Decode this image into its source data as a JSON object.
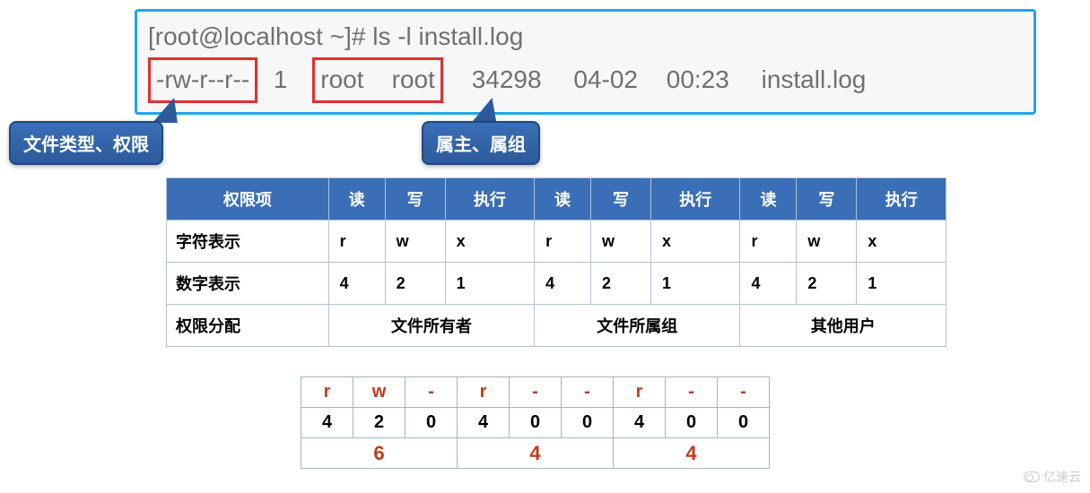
{
  "terminal": {
    "prompt": "[root@localhost ~]# ls -l install.log",
    "output": {
      "perm": "-rw-r--r--",
      "links": "1",
      "owner": "root",
      "group": "root",
      "size": "34298",
      "date": "04-02",
      "time": "00:23",
      "name": "install.log"
    }
  },
  "callouts": {
    "filetype_perm": "文件类型、权限",
    "owner_group": "属主、属组"
  },
  "perm_table": {
    "headers": [
      "权限项",
      "读",
      "写",
      "执行",
      "读",
      "写",
      "执行",
      "读",
      "写",
      "执行"
    ],
    "row_char_label": "字符表示",
    "row_char": [
      "r",
      "w",
      "x",
      "r",
      "w",
      "x",
      "r",
      "w",
      "x"
    ],
    "row_num_label": "数字表示",
    "row_num": [
      "4",
      "2",
      "1",
      "4",
      "2",
      "1",
      "4",
      "2",
      "1"
    ],
    "row_assign_label": "权限分配",
    "row_assign": [
      "文件所有者",
      "文件所属组",
      "其他用户"
    ]
  },
  "calc_table": {
    "chars": [
      "r",
      "w",
      "-",
      "r",
      "-",
      "-",
      "r",
      "-",
      "-"
    ],
    "nums": [
      "4",
      "2",
      "0",
      "4",
      "0",
      "0",
      "4",
      "0",
      "0"
    ],
    "sums": [
      "6",
      "4",
      "4"
    ]
  },
  "watermark": "亿速云"
}
